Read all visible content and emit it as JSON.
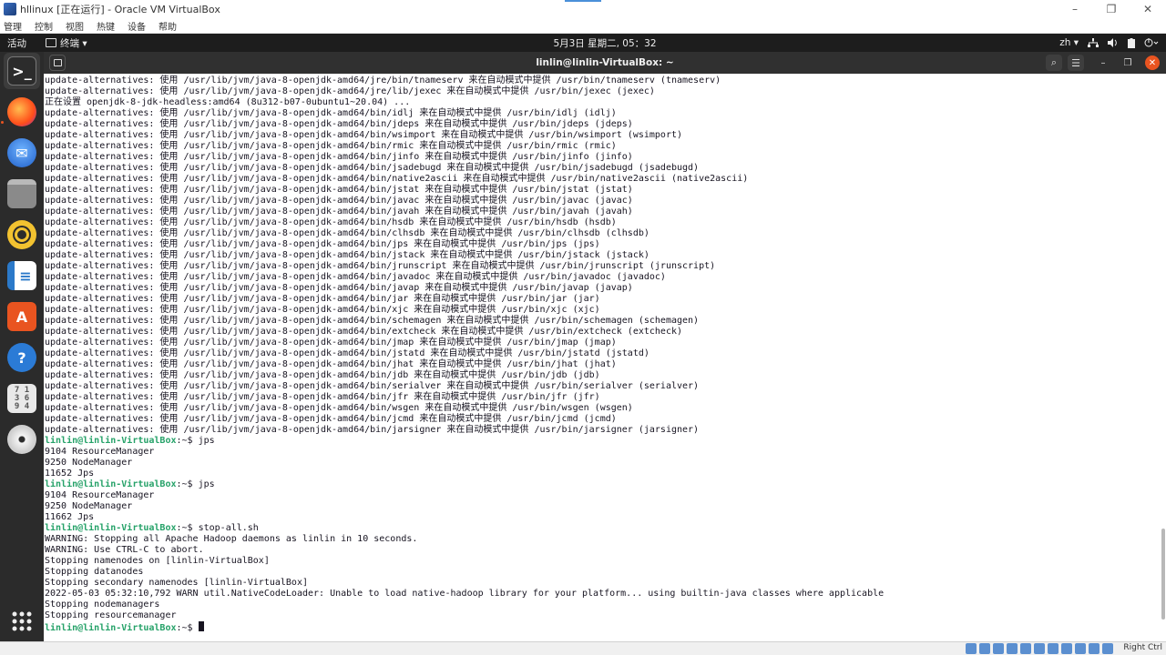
{
  "vbox": {
    "title": "hllinux [正在运行] - Oracle VM VirtualBox",
    "menu": [
      "管理",
      "控制",
      "视图",
      "热键",
      "设备",
      "帮助"
    ],
    "minimize": "–",
    "restore": "❐",
    "close": "✕",
    "host_key": "Right Ctrl"
  },
  "topbar": {
    "activities": "活动",
    "app_menu": "终端 ▾",
    "clock": "5月3日 星期二, 05：32",
    "lang": "zh ▾",
    "tray_icons": [
      "network-icon",
      "volume-icon",
      "battery-icon",
      "power-icon"
    ]
  },
  "dock": {
    "items": [
      {
        "name": "terminal",
        "label": ">_",
        "color": "#2c2c2c"
      },
      {
        "name": "firefox",
        "label": "🦊",
        "color": "#ff7a1a"
      },
      {
        "name": "thunderbird",
        "label": "✉",
        "color": "#2d72d9"
      },
      {
        "name": "files",
        "label": "▭",
        "color": "#9a9a9a"
      },
      {
        "name": "rhythmbox",
        "label": "◉",
        "color": "#f6c531"
      },
      {
        "name": "libreoffice-writer",
        "label": "≡",
        "color": "#2b79c9"
      },
      {
        "name": "ubuntu-software",
        "label": "A",
        "color": "#e95420"
      },
      {
        "name": "help",
        "label": "?",
        "color": "#2b7bd6"
      },
      {
        "name": "sudoku",
        "label": "#",
        "color": "#d8d8d8"
      },
      {
        "name": "dvd",
        "label": "◎",
        "color": "#cfcfcf"
      }
    ],
    "show_apps": "⋮⋮⋮"
  },
  "terminal": {
    "title": "linlin@linlin-VirtualBox: ~",
    "search_glyph": "⌕",
    "menu_glyph": "☰",
    "min_glyph": "–",
    "max_glyph": "❐",
    "close_glyph": "✕",
    "prompt_user": "linlin@linlin-VirtualBox",
    "prompt_sep": ":~$ ",
    "lines": [
      {
        "t": "update-alternatives: 使用 /usr/lib/jvm/java-8-openjdk-amd64/jre/bin/tnameserv 来在自动模式中提供 /usr/bin/tnameserv (tnameserv)"
      },
      {
        "t": "update-alternatives: 使用 /usr/lib/jvm/java-8-openjdk-amd64/jre/lib/jexec 来在自动模式中提供 /usr/bin/jexec (jexec)"
      },
      {
        "t": "正在设置 openjdk-8-jdk-headless:amd64 (8u312-b07-0ubuntu1~20.04) ..."
      },
      {
        "t": "update-alternatives: 使用 /usr/lib/jvm/java-8-openjdk-amd64/bin/idlj 来在自动模式中提供 /usr/bin/idlj (idlj)"
      },
      {
        "t": "update-alternatives: 使用 /usr/lib/jvm/java-8-openjdk-amd64/bin/jdeps 来在自动模式中提供 /usr/bin/jdeps (jdeps)"
      },
      {
        "t": "update-alternatives: 使用 /usr/lib/jvm/java-8-openjdk-amd64/bin/wsimport 来在自动模式中提供 /usr/bin/wsimport (wsimport)"
      },
      {
        "t": "update-alternatives: 使用 /usr/lib/jvm/java-8-openjdk-amd64/bin/rmic 来在自动模式中提供 /usr/bin/rmic (rmic)"
      },
      {
        "t": "update-alternatives: 使用 /usr/lib/jvm/java-8-openjdk-amd64/bin/jinfo 来在自动模式中提供 /usr/bin/jinfo (jinfo)"
      },
      {
        "t": "update-alternatives: 使用 /usr/lib/jvm/java-8-openjdk-amd64/bin/jsadebugd 来在自动模式中提供 /usr/bin/jsadebugd (jsadebugd)"
      },
      {
        "t": "update-alternatives: 使用 /usr/lib/jvm/java-8-openjdk-amd64/bin/native2ascii 来在自动模式中提供 /usr/bin/native2ascii (native2ascii)"
      },
      {
        "t": "update-alternatives: 使用 /usr/lib/jvm/java-8-openjdk-amd64/bin/jstat 来在自动模式中提供 /usr/bin/jstat (jstat)"
      },
      {
        "t": "update-alternatives: 使用 /usr/lib/jvm/java-8-openjdk-amd64/bin/javac 来在自动模式中提供 /usr/bin/javac (javac)"
      },
      {
        "t": "update-alternatives: 使用 /usr/lib/jvm/java-8-openjdk-amd64/bin/javah 来在自动模式中提供 /usr/bin/javah (javah)"
      },
      {
        "t": "update-alternatives: 使用 /usr/lib/jvm/java-8-openjdk-amd64/bin/hsdb 来在自动模式中提供 /usr/bin/hsdb (hsdb)"
      },
      {
        "t": "update-alternatives: 使用 /usr/lib/jvm/java-8-openjdk-amd64/bin/clhsdb 来在自动模式中提供 /usr/bin/clhsdb (clhsdb)"
      },
      {
        "t": "update-alternatives: 使用 /usr/lib/jvm/java-8-openjdk-amd64/bin/jps 来在自动模式中提供 /usr/bin/jps (jps)"
      },
      {
        "t": "update-alternatives: 使用 /usr/lib/jvm/java-8-openjdk-amd64/bin/jstack 来在自动模式中提供 /usr/bin/jstack (jstack)"
      },
      {
        "t": "update-alternatives: 使用 /usr/lib/jvm/java-8-openjdk-amd64/bin/jrunscript 来在自动模式中提供 /usr/bin/jrunscript (jrunscript)"
      },
      {
        "t": "update-alternatives: 使用 /usr/lib/jvm/java-8-openjdk-amd64/bin/javadoc 来在自动模式中提供 /usr/bin/javadoc (javadoc)"
      },
      {
        "t": "update-alternatives: 使用 /usr/lib/jvm/java-8-openjdk-amd64/bin/javap 来在自动模式中提供 /usr/bin/javap (javap)"
      },
      {
        "t": "update-alternatives: 使用 /usr/lib/jvm/java-8-openjdk-amd64/bin/jar 来在自动模式中提供 /usr/bin/jar (jar)"
      },
      {
        "t": "update-alternatives: 使用 /usr/lib/jvm/java-8-openjdk-amd64/bin/xjc 来在自动模式中提供 /usr/bin/xjc (xjc)"
      },
      {
        "t": "update-alternatives: 使用 /usr/lib/jvm/java-8-openjdk-amd64/bin/schemagen 来在自动模式中提供 /usr/bin/schemagen (schemagen)"
      },
      {
        "t": "update-alternatives: 使用 /usr/lib/jvm/java-8-openjdk-amd64/bin/extcheck 来在自动模式中提供 /usr/bin/extcheck (extcheck)"
      },
      {
        "t": "update-alternatives: 使用 /usr/lib/jvm/java-8-openjdk-amd64/bin/jmap 来在自动模式中提供 /usr/bin/jmap (jmap)"
      },
      {
        "t": "update-alternatives: 使用 /usr/lib/jvm/java-8-openjdk-amd64/bin/jstatd 来在自动模式中提供 /usr/bin/jstatd (jstatd)"
      },
      {
        "t": "update-alternatives: 使用 /usr/lib/jvm/java-8-openjdk-amd64/bin/jhat 来在自动模式中提供 /usr/bin/jhat (jhat)"
      },
      {
        "t": "update-alternatives: 使用 /usr/lib/jvm/java-8-openjdk-amd64/bin/jdb 来在自动模式中提供 /usr/bin/jdb (jdb)"
      },
      {
        "t": "update-alternatives: 使用 /usr/lib/jvm/java-8-openjdk-amd64/bin/serialver 来在自动模式中提供 /usr/bin/serialver (serialver)"
      },
      {
        "t": "update-alternatives: 使用 /usr/lib/jvm/java-8-openjdk-amd64/bin/jfr 来在自动模式中提供 /usr/bin/jfr (jfr)"
      },
      {
        "t": "update-alternatives: 使用 /usr/lib/jvm/java-8-openjdk-amd64/bin/wsgen 来在自动模式中提供 /usr/bin/wsgen (wsgen)"
      },
      {
        "t": "update-alternatives: 使用 /usr/lib/jvm/java-8-openjdk-amd64/bin/jcmd 来在自动模式中提供 /usr/bin/jcmd (jcmd)"
      },
      {
        "t": "update-alternatives: 使用 /usr/lib/jvm/java-8-openjdk-amd64/bin/jarsigner 来在自动模式中提供 /usr/bin/jarsigner (jarsigner)"
      },
      {
        "cmd": "jps"
      },
      {
        "t": "9104 ResourceManager"
      },
      {
        "t": "9250 NodeManager"
      },
      {
        "t": "11652 Jps"
      },
      {
        "cmd": "jps"
      },
      {
        "t": "9104 ResourceManager"
      },
      {
        "t": "9250 NodeManager"
      },
      {
        "t": "11662 Jps"
      },
      {
        "cmd": "stop-all.sh"
      },
      {
        "t": "WARNING: Stopping all Apache Hadoop daemons as linlin in 10 seconds."
      },
      {
        "t": "WARNING: Use CTRL-C to abort."
      },
      {
        "t": "Stopping namenodes on [linlin-VirtualBox]"
      },
      {
        "t": "Stopping datanodes"
      },
      {
        "t": "Stopping secondary namenodes [linlin-VirtualBox]"
      },
      {
        "t": "2022-05-03 05:32:10,792 WARN util.NativeCodeLoader: Unable to load native-hadoop library for your platform... using builtin-java classes where applicable"
      },
      {
        "t": "Stopping nodemanagers"
      },
      {
        "t": "Stopping resourcemanager"
      },
      {
        "cmd": "",
        "cursor": true
      }
    ]
  }
}
